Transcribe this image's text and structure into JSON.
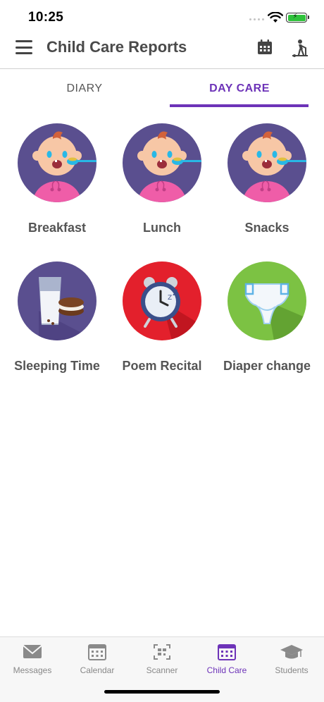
{
  "status": {
    "time": "10:25"
  },
  "header": {
    "title": "Child Care Reports"
  },
  "tabs": [
    {
      "label": "DIARY",
      "active": false
    },
    {
      "label": "DAY CARE",
      "active": true
    }
  ],
  "activities": [
    {
      "label": "Breakfast",
      "icon": "baby-eating-icon"
    },
    {
      "label": "Lunch",
      "icon": "baby-eating-icon"
    },
    {
      "label": "Snacks",
      "icon": "baby-eating-icon"
    },
    {
      "label": "Sleeping Time",
      "icon": "milk-and-cookies-icon"
    },
    {
      "label": "Poem Recital",
      "icon": "alarm-clock-icon"
    },
    {
      "label": "Diaper change",
      "icon": "diaper-icon"
    }
  ],
  "bottom_nav": [
    {
      "label": "Messages",
      "icon": "envelope-icon",
      "active": false
    },
    {
      "label": "Calendar",
      "icon": "calendar-icon",
      "active": false
    },
    {
      "label": "Scanner",
      "icon": "qr-scanner-icon",
      "active": false
    },
    {
      "label": "Child Care",
      "icon": "calendar-icon",
      "active": true
    },
    {
      "label": "Students",
      "icon": "graduation-cap-icon",
      "active": false
    }
  ],
  "colors": {
    "accent": "#6d33b8",
    "tile_purple": "#5a4f8f",
    "tile_red": "#e3202c",
    "tile_green": "#7cc243"
  }
}
